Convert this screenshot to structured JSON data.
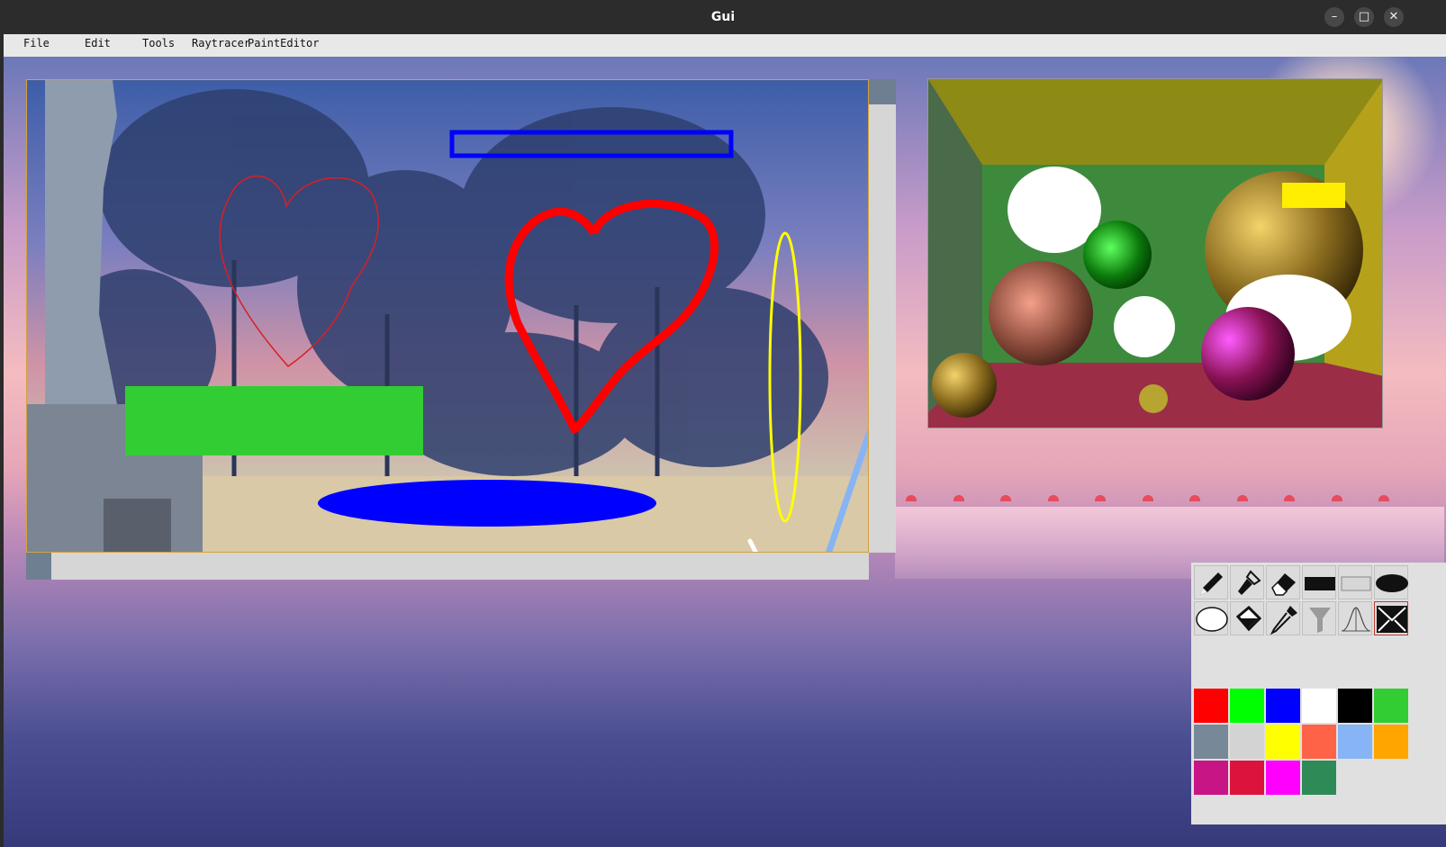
{
  "window": {
    "title": "Gui",
    "minimize_glyph": "–",
    "maximize_glyph": "□",
    "close_glyph": "✕"
  },
  "menubar": {
    "items": [
      "File",
      "Edit",
      "Tools",
      "Raytracer",
      "PaintEditor"
    ]
  },
  "canvas": {
    "strokes": [
      {
        "kind": "freehand-heart",
        "color": "#d81f26",
        "weight": "thin"
      },
      {
        "kind": "rectangle-outline",
        "color": "#0000ff"
      },
      {
        "kind": "freehand-heart",
        "color": "#ff0000",
        "weight": "thick"
      },
      {
        "kind": "ellipse-outline",
        "color": "#ffff00"
      },
      {
        "kind": "filled-rectangle",
        "color": "#32cd32"
      },
      {
        "kind": "filled-ellipse",
        "color": "#0000ff"
      },
      {
        "kind": "line",
        "color": "#87b4f4"
      }
    ]
  },
  "tools": [
    {
      "name": "pencil-tool",
      "icon": "pencil-icon"
    },
    {
      "name": "brush-tool",
      "icon": "brush-icon"
    },
    {
      "name": "eraser-tool",
      "icon": "eraser-icon"
    },
    {
      "name": "filled-rectangle-tool",
      "icon": "filled-rectangle-icon"
    },
    {
      "name": "rectangle-outline-tool",
      "icon": "rectangle-outline-icon"
    },
    {
      "name": "filled-ellipse-tool",
      "icon": "filled-ellipse-icon"
    },
    {
      "name": "ellipse-outline-tool",
      "icon": "ellipse-outline-icon"
    },
    {
      "name": "bucket-fill-tool",
      "icon": "paint-bucket-icon"
    },
    {
      "name": "color-picker-tool",
      "icon": "eyedropper-icon"
    },
    {
      "name": "filter-tool",
      "icon": "funnel-icon"
    },
    {
      "name": "gaussian-blur-tool",
      "icon": "gaussian-curve-icon"
    },
    {
      "name": "clear-tool",
      "icon": "envelope-x-icon",
      "selected": true
    }
  ],
  "colors": [
    "#ff0000",
    "#00ff00",
    "#0000ff",
    "#ffffff",
    "#000000",
    "#32cd32",
    "#778899",
    "#d3d3d3",
    "#ffff00",
    "#ff6347",
    "#87b4f4",
    "#ffa500",
    "#c71585",
    "#dc143c",
    "#ff00ff",
    "#2e8b57"
  ]
}
